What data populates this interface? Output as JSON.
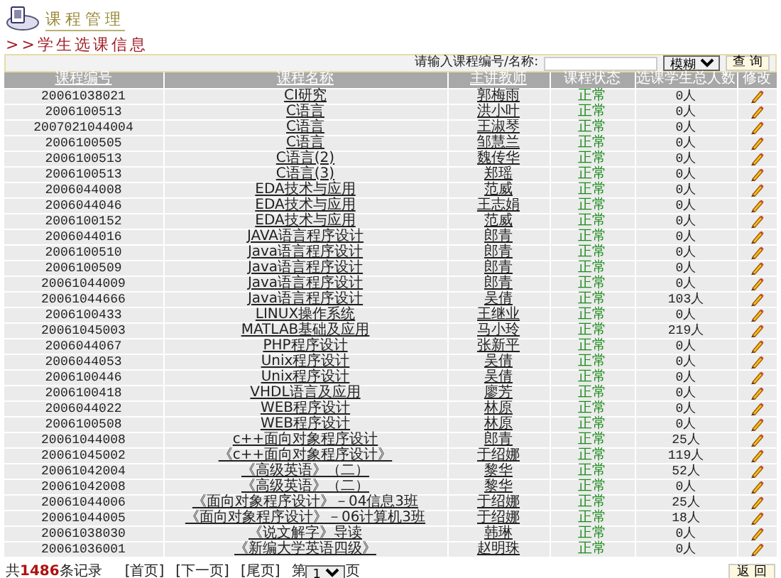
{
  "header": {
    "title": "课程管理"
  },
  "breadcrumb": ">>学生选课信息",
  "search": {
    "label": "请输入课程编号/名称:",
    "mode": "模糊",
    "button": "查 询"
  },
  "table": {
    "columns": [
      {
        "label": "课程编号",
        "kind": "link"
      },
      {
        "label": "课程名称",
        "kind": "link"
      },
      {
        "label": "主讲教师",
        "kind": "link"
      },
      {
        "label": "课程状态",
        "kind": "text"
      },
      {
        "label": "选课学生总人数",
        "kind": "text"
      },
      {
        "label": "修改",
        "kind": "text"
      }
    ],
    "rows": [
      {
        "code": "20061038021",
        "name": "CI研究",
        "teacher": "郭梅雨",
        "status": "正常",
        "students": "0人"
      },
      {
        "code": "2006100513",
        "name": "C语言",
        "teacher": "洪小叶",
        "status": "正常",
        "students": "0人"
      },
      {
        "code": "2007021044004",
        "name": "C语言",
        "teacher": "王淑琴",
        "status": "正常",
        "students": "0人"
      },
      {
        "code": "2006100505",
        "name": "C语言",
        "teacher": "邹慧兰",
        "status": "正常",
        "students": "0人"
      },
      {
        "code": "2006100513",
        "name": "C语言(2)",
        "teacher": "魏传华",
        "status": "正常",
        "students": "0人"
      },
      {
        "code": "2006100513",
        "name": "C语言(3)",
        "teacher": "郑瑶",
        "status": "正常",
        "students": "0人"
      },
      {
        "code": "2006044008",
        "name": "EDA技术与应用",
        "teacher": "范威",
        "status": "正常",
        "students": "0人"
      },
      {
        "code": "2006044046",
        "name": "EDA技术与应用",
        "teacher": "王志娟",
        "status": "正常",
        "students": "0人"
      },
      {
        "code": "2006100152",
        "name": "EDA技术与应用",
        "teacher": "范威",
        "status": "正常",
        "students": "0人"
      },
      {
        "code": "2006044016",
        "name": "JAVA语言程序设计",
        "teacher": "郎青",
        "status": "正常",
        "students": "0人"
      },
      {
        "code": "2006100510",
        "name": "Java语言程序设计",
        "teacher": "郎青",
        "status": "正常",
        "students": "0人"
      },
      {
        "code": "2006100509",
        "name": "Java语言程序设计",
        "teacher": "郎青",
        "status": "正常",
        "students": "0人"
      },
      {
        "code": "20061044009",
        "name": "Java语言程序设计",
        "teacher": "郎青",
        "status": "正常",
        "students": "0人"
      },
      {
        "code": "20061044666",
        "name": "Java语言程序设计",
        "teacher": "吴倩",
        "status": "正常",
        "students": "103人"
      },
      {
        "code": "2006100433",
        "name": "LINUX操作系统",
        "teacher": "王继业",
        "status": "正常",
        "students": "0人"
      },
      {
        "code": "20061045003",
        "name": "MATLAB基础及应用",
        "teacher": "马小玲",
        "status": "正常",
        "students": "219人"
      },
      {
        "code": "2006044067",
        "name": "PHP程序设计",
        "teacher": "张新平",
        "status": "正常",
        "students": "0人"
      },
      {
        "code": "2006044053",
        "name": "Unix程序设计",
        "teacher": "吴倩",
        "status": "正常",
        "students": "0人"
      },
      {
        "code": "2006100446",
        "name": "Unix程序设计",
        "teacher": "吴倩",
        "status": "正常",
        "students": "0人"
      },
      {
        "code": "2006100418",
        "name": "VHDL语言及应用",
        "teacher": "廖芳",
        "status": "正常",
        "students": "0人"
      },
      {
        "code": "2006044022",
        "name": "WEB程序设计",
        "teacher": "林原",
        "status": "正常",
        "students": "0人"
      },
      {
        "code": "2006100508",
        "name": "WEB程序设计",
        "teacher": "林原",
        "status": "正常",
        "students": "0人"
      },
      {
        "code": "20061044008",
        "name": "c++面向对象程序设计",
        "teacher": "郎青",
        "status": "正常",
        "students": "25人"
      },
      {
        "code": "20061045002",
        "name": "《c++面向对象程序设计》",
        "teacher": "于绍娜",
        "status": "正常",
        "students": "119人"
      },
      {
        "code": "20061042004",
        "name": "《高级英语》（二）",
        "teacher": "黎华",
        "status": "正常",
        "students": "52人"
      },
      {
        "code": "20061042008",
        "name": "《高级英语》（二）",
        "teacher": "黎华",
        "status": "正常",
        "students": "0人"
      },
      {
        "code": "20061044006",
        "name": "《面向对象程序设计》－04信息3班",
        "teacher": "于绍娜",
        "status": "正常",
        "students": "25人"
      },
      {
        "code": "20061044005",
        "name": "《面向对象程序设计》－06计算机3班",
        "teacher": "于绍娜",
        "status": "正常",
        "students": "18人"
      },
      {
        "code": "20061038030",
        "name": "《说文解字》导读",
        "teacher": "韩琳",
        "status": "正常",
        "students": "0人"
      },
      {
        "code": "20061036001",
        "name": "《新编大学英语四级》",
        "teacher": "赵明珠",
        "status": "正常",
        "students": "0人"
      }
    ]
  },
  "footer": {
    "record_count": "共**1486**条记录",
    "pager": [
      "[首页]",
      "[下一页]",
      "[尾页]"
    ],
    "page_prefix": "第",
    "page": "1",
    "page_suffix": "页",
    "back_button": "返 回"
  }
}
